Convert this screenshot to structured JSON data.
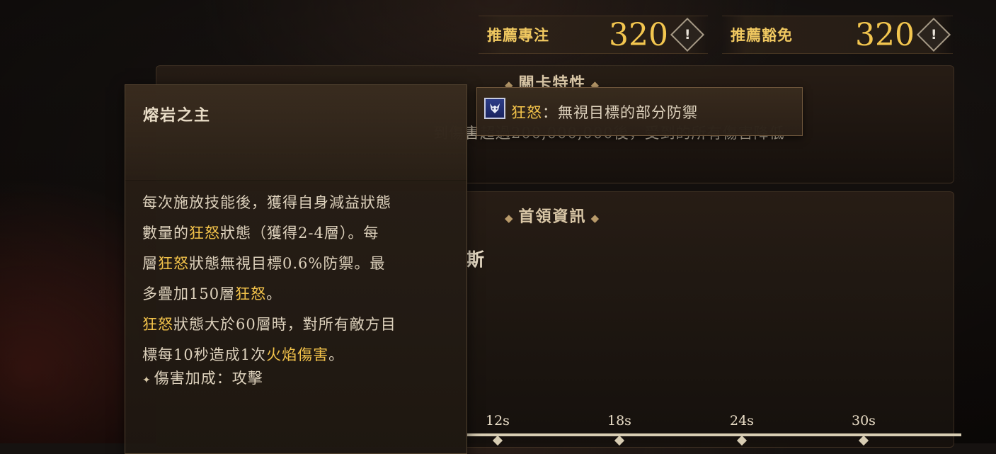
{
  "recommend": {
    "focus_label": "推薦專注",
    "focus_value": "320",
    "immunity_label": "推薦豁免",
    "immunity_value": "320",
    "warn_glyph": "!"
  },
  "panels": {
    "stage_traits_title": "關卡特性",
    "stage_traits_text_fragment": "到傷害超過200,000,000後，受到的所有傷害降低",
    "boss_info_title": "首領資訊",
    "boss_name_fragment": "斯"
  },
  "tooltip": {
    "title": "熔岩之主",
    "lines": [
      {
        "parts": [
          {
            "t": "每次施放技能後，獲得自身減益狀態",
            "hl": false
          }
        ]
      },
      {
        "parts": [
          {
            "t": "數量的",
            "hl": false
          },
          {
            "t": "狂怒",
            "hl": true
          },
          {
            "t": "狀態（獲得2-4層）。每",
            "hl": false
          }
        ]
      },
      {
        "parts": [
          {
            "t": "層",
            "hl": false
          },
          {
            "t": "狂怒",
            "hl": true
          },
          {
            "t": "狀態無視目標0.6%防禦。最",
            "hl": false
          }
        ]
      },
      {
        "parts": [
          {
            "t": "多疊加150層",
            "hl": false
          },
          {
            "t": "狂怒",
            "hl": true
          },
          {
            "t": "。",
            "hl": false
          }
        ]
      },
      {
        "parts": [
          {
            "t": "狂怒",
            "hl": true
          },
          {
            "t": "狀態大於60層時，對所有敵方目",
            "hl": false
          }
        ]
      },
      {
        "parts": [
          {
            "t": "標每10秒造成1次",
            "hl": false
          },
          {
            "t": "火焰傷害",
            "hl": true
          },
          {
            "t": "。",
            "hl": false
          }
        ]
      }
    ],
    "bonus_label": "傷害加成：攻擊"
  },
  "mini_tooltip": {
    "keyword": "狂怒",
    "description": "：無視目標的部分防禦",
    "icon": "demon-mask-icon"
  },
  "timeline": {
    "ticks": [
      "12s",
      "18s",
      "24s",
      "30s"
    ]
  },
  "colors": {
    "highlight": "#f2c24a",
    "value_gold": "#f3c64f"
  }
}
